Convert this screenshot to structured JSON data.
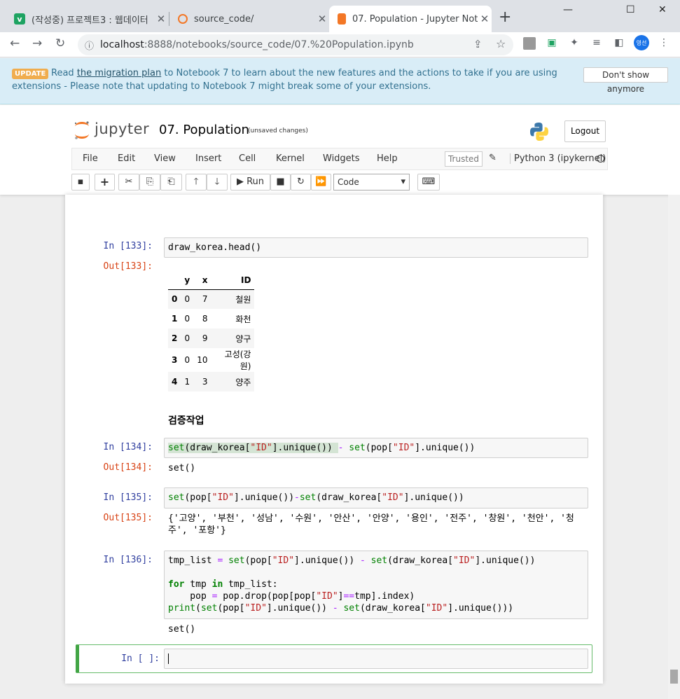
{
  "browser": {
    "tabs": [
      {
        "title": "(작성중) 프로젝트3 : 웹데이터",
        "favicon": "v",
        "color": "#1ea362"
      },
      {
        "title": "source_code/",
        "favicon": "jupyter-icon",
        "color": "#f37726"
      },
      {
        "title": "07. Population - Jupyter Noteb",
        "favicon": "book-icon",
        "color": "#f37726"
      }
    ],
    "url_host": "localhost",
    "url_path": ":8888/notebooks/source_code/07.%20Population.ipynb",
    "avatar": "영선",
    "window_controls": {
      "minimize": "—",
      "maximize": "☐",
      "close": "✕"
    }
  },
  "banner": {
    "badge": "UPDATE",
    "pre": "Read ",
    "link": "the migration plan",
    "post": " to Notebook 7 to learn about the new features and the actions to take if you are using extensions - Please note that updating to Notebook 7 might break some of your extensions.",
    "button": "Don't show anymore"
  },
  "header": {
    "logo_text": "jupyter",
    "title": "07. Population",
    "unsaved": "(unsaved changes)",
    "logout": "Logout"
  },
  "menu": {
    "items": [
      "File",
      "Edit",
      "View",
      "Insert",
      "Cell",
      "Kernel",
      "Widgets",
      "Help"
    ],
    "trusted": "Trusted",
    "kernel": "Python 3 (ipykernel)"
  },
  "toolbar": {
    "run": "Run",
    "cell_type": "Code"
  },
  "cells": {
    "c133": {
      "in": "In [133]:",
      "out": "Out[133]:",
      "code": "draw_korea.head()"
    },
    "df": {
      "columns": [
        "",
        "y",
        "x",
        "ID"
      ],
      "rows": [
        [
          "0",
          "0",
          "7",
          "철원"
        ],
        [
          "1",
          "0",
          "8",
          "화천"
        ],
        [
          "2",
          "0",
          "9",
          "양구"
        ],
        [
          "3",
          "0",
          "10",
          "고성(강원)"
        ],
        [
          "4",
          "1",
          "3",
          "양주"
        ]
      ]
    },
    "md": "검증작업",
    "c134": {
      "in": "In [134]:",
      "out": "Out[134]:",
      "result": "set()"
    },
    "c135": {
      "in": "In [135]:",
      "out": "Out[135]:",
      "result": "{'고양', '부천', '성남', '수원', '안산', '안양', '용인', '전주', '창원', '천안', '청\n주', '포항'}"
    },
    "c136": {
      "in": "In [136]:",
      "result": "set()"
    },
    "empty": {
      "in": "In [ ]:"
    }
  }
}
